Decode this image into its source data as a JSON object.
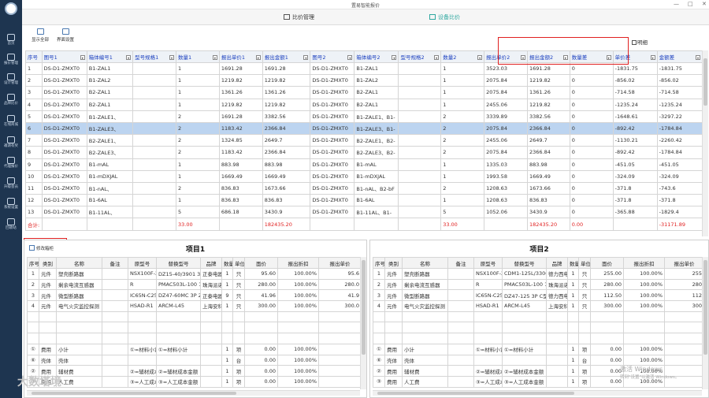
{
  "app": {
    "title": "置易智能报价"
  },
  "window": {
    "min": "—",
    "max": "□",
    "close": "✕"
  },
  "sidebar": {
    "items": [
      {
        "label": "首页",
        "icon": "home-icon"
      },
      {
        "label": "报价管理",
        "icon": "quote-icon"
      },
      {
        "label": "设计管理",
        "icon": "design-icon"
      },
      {
        "label": "品牌比价",
        "icon": "compare-icon"
      },
      {
        "label": "在线商城",
        "icon": "shop-icon"
      },
      {
        "label": "邀请有奖",
        "icon": "gift-icon"
      },
      {
        "label": "代理报价",
        "icon": "agent-icon"
      },
      {
        "label": "升级会员",
        "icon": "vip-icon"
      },
      {
        "label": "系统设置",
        "icon": "settings-icon"
      },
      {
        "label": "回收站",
        "icon": "recycle-icon"
      }
    ]
  },
  "tabs": [
    {
      "label": "比价管理",
      "selected": false
    },
    {
      "label": "设备比价",
      "selected": true
    }
  ],
  "toolbar": {
    "show_all": "显示全部",
    "settings": "界面设置",
    "bright_label": "明细"
  },
  "compare_table": {
    "headers": [
      "序号",
      "图号1",
      "箱体编号1",
      "型号规格1",
      "数量1",
      "报出单价1",
      "报出金额1",
      "图号2",
      "箱体编号2",
      "型号规格2",
      "数量2",
      "报出单价2",
      "报出金额2",
      "数量差",
      "单价差",
      "金额差"
    ],
    "rows": [
      [
        "1",
        "DS-D1-ZMXT0",
        "B1-ZAL1",
        "",
        "1",
        "1691.28",
        "1691.28",
        "DS-D1-ZMXT0",
        "B1-ZAL1",
        "",
        "1",
        "3523.03",
        "1691.28",
        "0",
        "-1831.75",
        "-1831.75"
      ],
      [
        "2",
        "DS-D1-ZMXT0",
        "B1-ZAL2",
        "",
        "1",
        "1219.82",
        "1219.82",
        "DS-D1-ZMXT0",
        "B1-ZAL2",
        "",
        "1",
        "2075.84",
        "1219.82",
        "0",
        "-856.02",
        "-856.02"
      ],
      [
        "3",
        "DS-D1-ZMXT0",
        "B2-ZAL1",
        "",
        "1",
        "1361.26",
        "1361.26",
        "DS-D1-ZMXT0",
        "B2-ZAL1",
        "",
        "1",
        "2075.84",
        "1361.26",
        "0",
        "-714.58",
        "-714.58"
      ],
      [
        "4",
        "DS-D1-ZMXT0",
        "B2-ZAL1",
        "",
        "1",
        "1219.82",
        "1219.82",
        "DS-D1-ZMXT0",
        "B2-ZAL1",
        "",
        "1",
        "2455.06",
        "1219.82",
        "0",
        "-1235.24",
        "-1235.24"
      ],
      [
        "5",
        "DS-D1-ZMXT0",
        "B1-ZALE1、",
        "",
        "2",
        "1691.28",
        "3382.56",
        "DS-D1-ZMXT0",
        "B1-ZALE1、B1-",
        "",
        "2",
        "3339.89",
        "3382.56",
        "0",
        "-1648.61",
        "-3297.22"
      ],
      [
        "6",
        "DS-D1-ZMXT0",
        "B1-ZALE3、",
        "",
        "2",
        "1183.42",
        "2366.84",
        "DS-D1-ZMXT0",
        "B1-ZALE3、B1-",
        "",
        "2",
        "2075.84",
        "2366.84",
        "0",
        "-892.42",
        "-1784.84"
      ],
      [
        "7",
        "DS-D1-ZMXT0",
        "B2-ZALE1、",
        "",
        "2",
        "1324.85",
        "2649.7",
        "DS-D1-ZMXT0",
        "B2-ZALE1、B2-",
        "",
        "2",
        "2455.06",
        "2649.7",
        "0",
        "-1130.21",
        "-2260.42"
      ],
      [
        "8",
        "DS-D1-ZMXT0",
        "B2-ZALE3、",
        "",
        "2",
        "1183.42",
        "2366.84",
        "DS-D1-ZMXT0",
        "B2-ZALE3、B2-",
        "",
        "2",
        "2075.84",
        "2366.84",
        "0",
        "-892.42",
        "-1784.84"
      ],
      [
        "9",
        "DS-D1-ZMXT0",
        "B1-mAL",
        "",
        "1",
        "883.98",
        "883.98",
        "DS-D1-ZMXT0",
        "B1-mAL",
        "",
        "1",
        "1335.03",
        "883.98",
        "0",
        "-451.05",
        "-451.05"
      ],
      [
        "10",
        "DS-D1-ZMXT0",
        "B1-mDXJAL",
        "",
        "1",
        "1669.49",
        "1669.49",
        "DS-D1-ZMXT0",
        "B1-mDXJAL",
        "",
        "1",
        "1993.58",
        "1669.49",
        "0",
        "-324.09",
        "-324.09"
      ],
      [
        "11",
        "DS-D1-ZMXT0",
        "B1-nAL、",
        "",
        "2",
        "836.83",
        "1673.66",
        "DS-D1-ZMXT0",
        "B1-nAL、B2-bF",
        "",
        "2",
        "1208.63",
        "1673.66",
        "0",
        "-371.8",
        "-743.6"
      ],
      [
        "12",
        "DS-D1-ZMXT0",
        "B1-6AL",
        "",
        "1",
        "836.83",
        "836.83",
        "DS-D1-ZMXT0",
        "B1-6AL",
        "",
        "1",
        "1208.63",
        "836.83",
        "0",
        "-371.8",
        "-371.8"
      ],
      [
        "13",
        "DS-D1-ZMXT0",
        "B1-11AL、",
        "",
        "5",
        "686.18",
        "3430.9",
        "DS-D1-ZMXT0",
        "B1-11AL、B1-",
        "",
        "5",
        "1052.06",
        "3430.9",
        "0",
        "-365.88",
        "-1829.4"
      ]
    ],
    "selected_row": 5,
    "summary": {
      "label": "合计:",
      "qty1": "33.00",
      "amt1": "182435.20",
      "qty2": "33.00",
      "amt2": "182435.20",
      "qty_diff": "0.00",
      "amt_diff": "-31171.89"
    }
  },
  "left_panel": {
    "title": "项目1",
    "edit_button": "修改箱柜",
    "headers": [
      "序号",
      "类别",
      "名称",
      "备注",
      "原型号",
      "替换型号",
      "品牌",
      "数量",
      "单位",
      "面价",
      "报出折扣",
      "报出单价"
    ],
    "rows": [
      [
        "1",
        "元件",
        "塑壳断路器",
        "",
        "NSX100F-3.",
        "DZ15-40/3901 32A 透明",
        "正泰电器",
        "1",
        "只",
        "95.60",
        "100.00%",
        "95.6"
      ],
      [
        "2",
        "元件",
        "剩余电流互感器",
        "",
        "R",
        "PMAC503L-100 100A",
        "珠海派诺",
        "1",
        "只",
        "280.00",
        "100.00%",
        "280.0"
      ],
      [
        "3",
        "元件",
        "微型断路器",
        "",
        "IC65N-C25A",
        "DZ47-60MC 3P 25A",
        "正泰电器",
        "9",
        "只",
        "41.96",
        "100.00%",
        "41.9"
      ],
      [
        "4",
        "元件",
        "电气火灾监控探测",
        "",
        "HSAD-R1",
        "ARCM-L45",
        "上海安科",
        "1",
        "只",
        "300.00",
        "100.00%",
        "300.0"
      ]
    ],
    "footer_rows": [
      [
        "①",
        "费用",
        "小计",
        "",
        "①=材料小计",
        "①=材料小计",
        "",
        "1",
        "项",
        "0.00",
        "100.00%",
        ""
      ],
      [
        "⑥",
        "壳体",
        "壳体",
        "",
        "",
        "",
        "",
        "1",
        "台",
        "0.00",
        "100.00%",
        ""
      ],
      [
        "②",
        "费用",
        "辅材费",
        "",
        "②=辅材成本",
        "②=辅材成本金额",
        "",
        "1",
        "项",
        "0.00",
        "100.00%",
        ""
      ],
      [
        "③",
        "费用",
        "人工费",
        "",
        "③=人工成本",
        "③=人工成本金额",
        "",
        "1",
        "项",
        "0.00",
        "100.00%",
        ""
      ]
    ]
  },
  "right_panel": {
    "title": "项目2",
    "headers": [
      "序号",
      "类别",
      "名称",
      "备注",
      "原型号",
      "替换型号",
      "品牌",
      "数量",
      "单位",
      "面价",
      "报出折扣",
      "报出单价"
    ],
    "rows": [
      [
        "1",
        "元件",
        "塑壳断路器",
        "",
        "NSX100F-3.",
        "CDM1-125L/3300 32A",
        "德力西电",
        "1",
        "只",
        "255.00",
        "100.00%",
        "255"
      ],
      [
        "2",
        "元件",
        "剩余电流互感器",
        "",
        "R",
        "PMAC503L-100 100A",
        "珠海派诺",
        "1",
        "只",
        "280.00",
        "100.00%",
        "280"
      ],
      [
        "3",
        "元件",
        "微型断路器",
        "",
        "IC65N-C25A",
        "DZ47-125 3P C型 63A",
        "德力西电",
        "1",
        "只",
        "112.50",
        "100.00%",
        "112"
      ],
      [
        "4",
        "元件",
        "电气火灾监控探测",
        "",
        "HSAD-R1",
        "ARCM-L45",
        "上海安科",
        "1",
        "只",
        "300.00",
        "100.00%",
        "300"
      ]
    ],
    "footer_rows": [
      [
        "①",
        "费用",
        "小计",
        "",
        "①=材料小计",
        "①=材料小计",
        "",
        "1",
        "项",
        "0.00",
        "100.00%",
        ""
      ],
      [
        "⑥",
        "壳体",
        "壳体",
        "",
        "",
        "",
        "",
        "1",
        "台",
        "0.00",
        "100.00%",
        ""
      ],
      [
        "②",
        "费用",
        "辅材费",
        "",
        "②=辅材成本",
        "②=辅材成本金额",
        "",
        "1",
        "项",
        "0.00",
        "100.00%",
        ""
      ],
      [
        "③",
        "费用",
        "人工费",
        "",
        "③=人工成本",
        "③=人工成本金额",
        "",
        "1",
        "项",
        "0.00",
        "100.00%",
        ""
      ]
    ]
  },
  "watermark": {
    "line1": "激活 Windows",
    "line2": "转到\"设置\"以激活 Windows。",
    "brand": "大数塔境"
  }
}
